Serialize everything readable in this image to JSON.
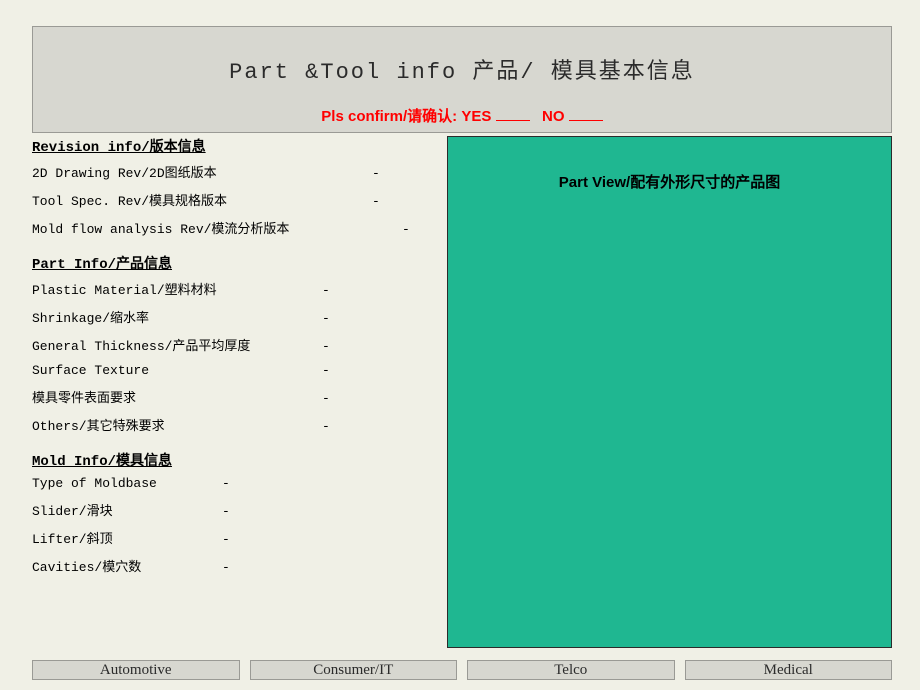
{
  "header": {
    "title": "Part &Tool info 产品/ 模具基本信息",
    "confirm_prefix": "Pls confirm/请确认: YES",
    "confirm_no": "NO"
  },
  "revision": {
    "heading": "Revision info/版本信息",
    "items": [
      {
        "label": "2D Drawing Rev/2D图纸版本",
        "value": "-",
        "label_w": 340
      },
      {
        "label": "Tool Spec. Rev/模具规格版本",
        "value": "-",
        "label_w": 340
      },
      {
        "label": "Mold flow analysis Rev/模流分析版本",
        "value": "-",
        "label_w": 370
      }
    ]
  },
  "part": {
    "heading": "Part Info/产品信息",
    "items": [
      {
        "label": "Plastic Material/塑料材料",
        "value": "-",
        "label_w": 290
      },
      {
        "label": "Shrinkage/缩水率",
        "value": "-",
        "label_w": 290
      },
      {
        "label": "General Thickness/产品平均厚度",
        "value": "-",
        "label_w": 290
      },
      {
        "label": "Surface Texture",
        "value": "-",
        "label_w": 290
      },
      {
        "label": "模具零件表面要求",
        "value": "-",
        "label_w": 290
      },
      {
        "label": "Others/其它特殊要求",
        "value": "-",
        "label_w": 290
      }
    ]
  },
  "mold": {
    "heading": "Mold Info/模具信息",
    "items": [
      {
        "label": "Type of Moldbase",
        "value": "-",
        "label_w": 190
      },
      {
        "label": "Slider/滑块",
        "value": "-",
        "label_w": 190
      },
      {
        "label": "Lifter/斜顶",
        "value": "-",
        "label_w": 190
      },
      {
        "label": "Cavities/模穴数",
        "value": "-",
        "label_w": 190
      }
    ]
  },
  "partview": {
    "title": "Part View/配有外形尺寸的产品图"
  },
  "footer": {
    "items": [
      "Automotive",
      "Consumer/IT",
      "Telco",
      "Medical"
    ]
  }
}
